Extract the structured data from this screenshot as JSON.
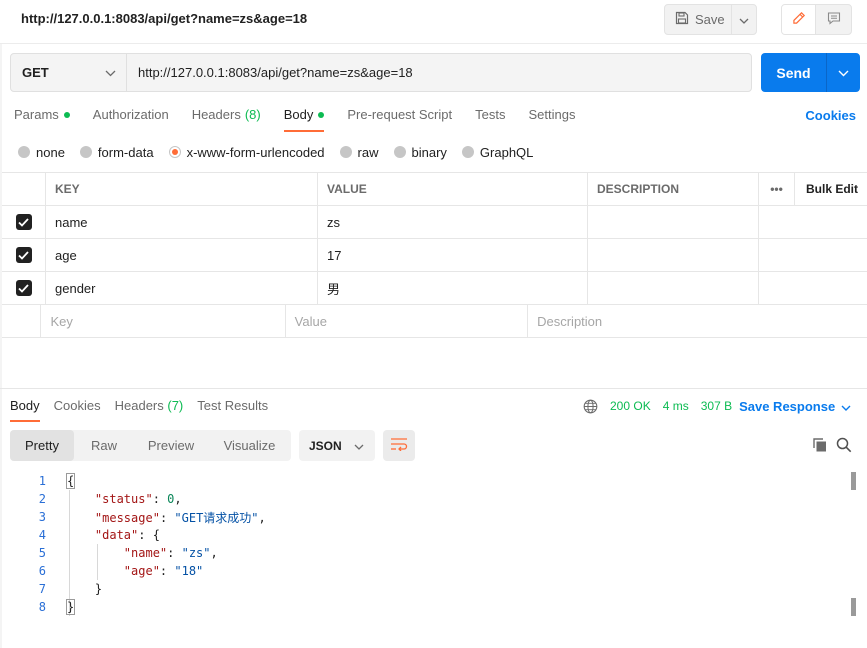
{
  "header": {
    "title": "http://127.0.0.1:8083/api/get?name=zs&age=18",
    "save_label": "Save"
  },
  "request": {
    "method": "GET",
    "url": "http://127.0.0.1:8083/api/get?name=zs&age=18",
    "send_label": "Send"
  },
  "tabs": {
    "params": "Params",
    "authorization": "Authorization",
    "headers": "Headers",
    "headers_count": "(8)",
    "body": "Body",
    "prerequest": "Pre-request Script",
    "tests": "Tests",
    "settings": "Settings",
    "cookies": "Cookies"
  },
  "body_types": [
    "none",
    "form-data",
    "x-www-form-urlencoded",
    "raw",
    "binary",
    "GraphQL"
  ],
  "table": {
    "headers": {
      "key": "KEY",
      "value": "VALUE",
      "description": "DESCRIPTION",
      "more": "•••",
      "bulk": "Bulk Edit"
    },
    "rows": [
      {
        "key": "name",
        "value": "zs",
        "checked": true
      },
      {
        "key": "age",
        "value": "17",
        "checked": true
      },
      {
        "key": "gender",
        "value": "男",
        "checked": true
      }
    ],
    "placeholders": {
      "key": "Key",
      "value": "Value",
      "description": "Description"
    }
  },
  "response": {
    "tabs": {
      "body": "Body",
      "cookies": "Cookies",
      "headers": "Headers",
      "headers_count": "(7)",
      "test_results": "Test Results"
    },
    "status": "200 OK",
    "time": "4 ms",
    "size": "307 B",
    "save_label": "Save Response",
    "views": [
      "Pretty",
      "Raw",
      "Preview",
      "Visualize"
    ],
    "format": "JSON",
    "line_numbers": [
      "1",
      "2",
      "3",
      "4",
      "5",
      "6",
      "7",
      "8"
    ],
    "json": {
      "status_key": "\"status\"",
      "status_val": "0",
      "message_key": "\"message\"",
      "message_val": "\"GET请求成功\"",
      "data_key": "\"data\"",
      "name_key": "\"name\"",
      "name_val": "\"zs\"",
      "age_key": "\"age\"",
      "age_val": "\"18\""
    }
  },
  "colors": {
    "accent": "#ff6c37",
    "primary": "#097bed",
    "success": "#0cbb52"
  }
}
